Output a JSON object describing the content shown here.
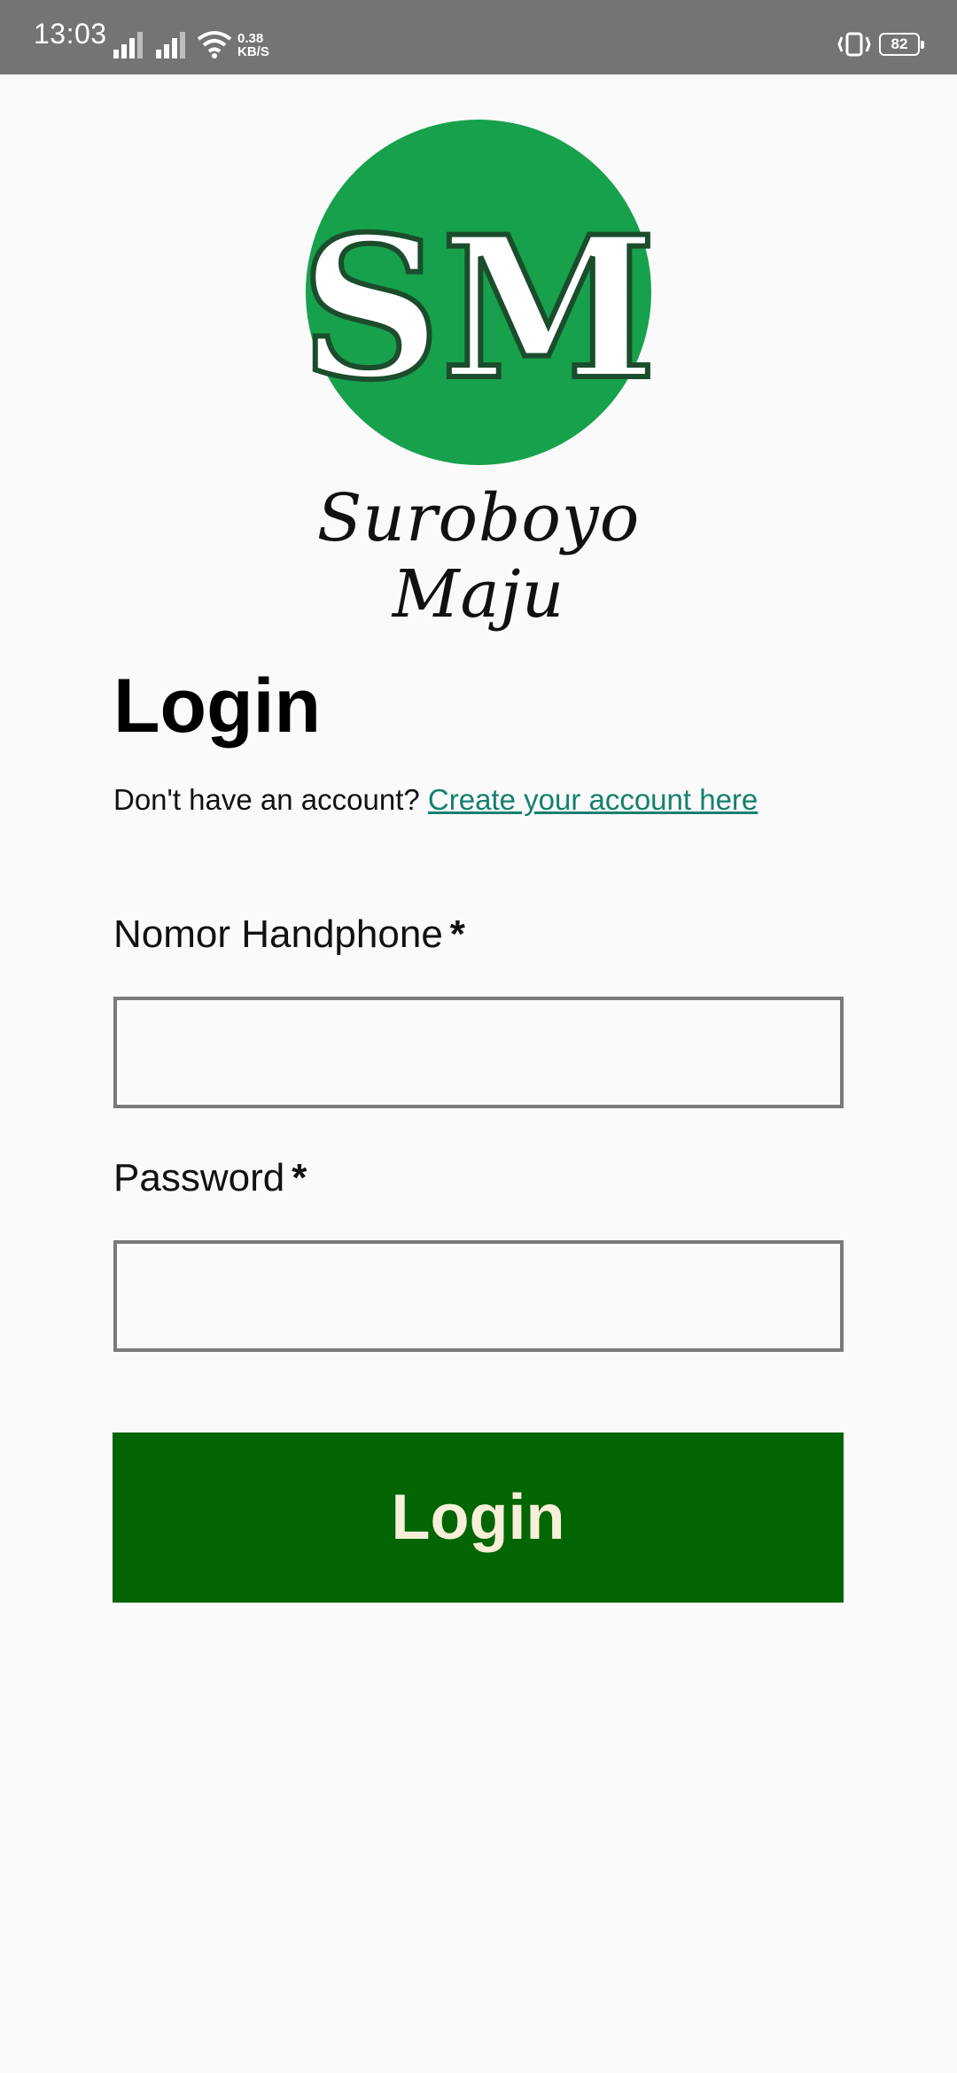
{
  "status_bar": {
    "time": "13:03",
    "speed_value": "0.38",
    "speed_unit": "KB/S",
    "battery": "82"
  },
  "brand": {
    "logo_text": "SM",
    "name": "Suroboyo Maju",
    "logo_color": "#17a14d"
  },
  "login": {
    "title": "Login",
    "signup_prompt": "Don't have an account? ",
    "signup_link": "Create your account here",
    "phone_label": "Nomor Handphone",
    "password_label": "Password",
    "required_mark": "*",
    "phone_value": "",
    "password_value": "",
    "button_label": "Login",
    "button_color": "#036503",
    "link_color": "#15806e"
  }
}
